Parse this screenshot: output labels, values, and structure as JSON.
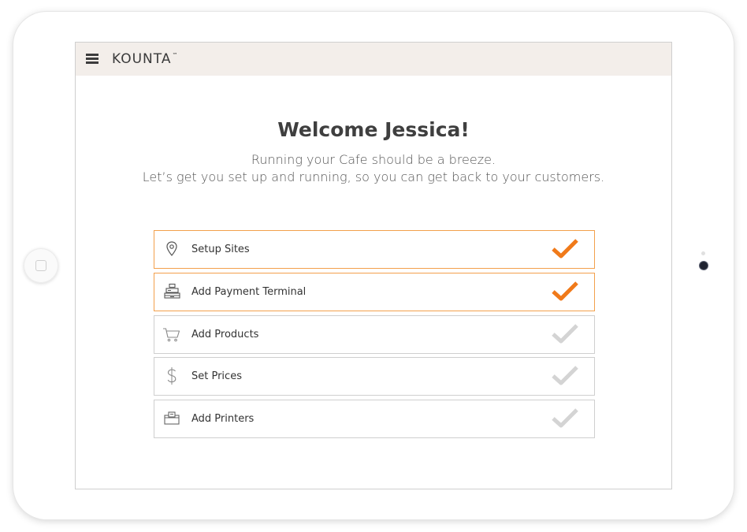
{
  "header": {
    "logo_text": "KOUNTA",
    "logo_mark": "™"
  },
  "welcome": {
    "title": "Welcome Jessica!",
    "line1": "Running your Cafe should be a breeze.",
    "line2": "Let’s get you set up and running, so you can get back to your customers."
  },
  "colors": {
    "accent": "#f07a1a",
    "pending": "#d4d4d4",
    "done_border": "#f3a04c",
    "topbar": "#f3eeea"
  },
  "steps": [
    {
      "label": "Setup Sites",
      "icon": "map-pin-icon",
      "done": true
    },
    {
      "label": "Add Payment Terminal",
      "icon": "cash-register-icon",
      "done": true
    },
    {
      "label": "Add Products",
      "icon": "shopping-cart-icon",
      "done": false
    },
    {
      "label": "Set Prices",
      "icon": "dollar-icon",
      "done": false
    },
    {
      "label": "Add Printers",
      "icon": "printer-icon",
      "done": false
    }
  ]
}
